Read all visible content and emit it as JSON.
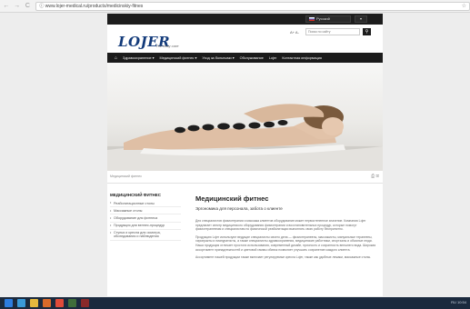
{
  "browser": {
    "url": "www.lojer-medical.ru/products/medicinskiy-fitnes",
    "back": "←",
    "forward": "→",
    "reload": "C",
    "info": "ⓘ",
    "star": "☆"
  },
  "topbar": {
    "language": "Русский",
    "lang_toggle": "▾"
  },
  "header": {
    "logo": "LOJER",
    "tagline": "For easy care",
    "font_size": "A+ A-",
    "search_placeholder": "Поиск по сайту",
    "search_icon": "search-icon"
  },
  "menu": {
    "home_icon": "home-icon",
    "items": [
      "Здравоохранение ▾",
      "Медицинский фитнес ▾",
      "Уход за больными ▾",
      "Обслуживание",
      "Lojer",
      "Контактная информация"
    ]
  },
  "hero": {
    "caption": "Медицинский фитнес",
    "share": "⎙ ✉"
  },
  "sidebar": {
    "title": "МЕДИЦИНСКИЙ ФИТНЕС",
    "items": [
      "Реабилитационные столы",
      "Массажные столы",
      "Оборудование для фитнеса",
      "Продукция для велнес-процедур",
      "Стулья и кресла для осмотра, обследования и наблюдения"
    ]
  },
  "main": {
    "title": "Медицинский фитнес",
    "subtitle": "Эргономика для персонала, забота о клиенте",
    "paragraphs": [
      "Для специалистов физиотерапии и массажа клиентов оборудование может первостепенное значение. Компания Lojer предлагает спектр медицинского оборудования физиотерапии и восстановительных процедур, которые помогут физиотерапевтам и специалистам по физической реабилитации выполнять свою работу бесприпятно.",
      "Продукцию Lojer используют ведущие специалисты своего дела — физиотерапевты, массажисты, мануальные терапевты, хиропракты и ниапуратисты, а также специалисты здравоохранения, медицинские работники, спортзалы и обычные люди. Наша продукция отличает простота использования, современный дизайн, прочность и сохранность внешнего вида. Широкая ассортимент принадлежностей и цветовой гаммы обивок позволяет улучшать сохранение каждого клиента.",
      "Ассортимент нашей продукции также включает регулируемые кресла Lojer, также как удобные лежаки, массажные столы."
    ]
  },
  "taskbar": {
    "tray_text": "RU  10:54"
  }
}
